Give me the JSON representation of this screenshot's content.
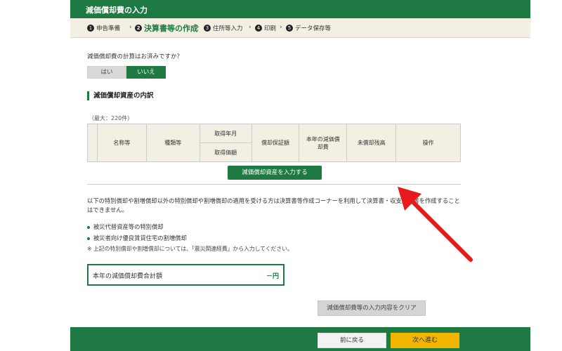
{
  "header": {
    "title": "減価償却費の入力"
  },
  "steps": [
    {
      "num": "1",
      "label": "申告準備"
    },
    {
      "num": "2",
      "label": "決算書等の作成"
    },
    {
      "num": "3",
      "label": "住所等入力"
    },
    {
      "num": "4",
      "label": "印刷"
    },
    {
      "num": "5",
      "label": "データ保存等"
    }
  ],
  "question": {
    "text": "減価償却費の計算はお済みですか？",
    "yes_label": "はい",
    "no_label": "いいえ"
  },
  "assets": {
    "title": "減価償却資産の内訳",
    "max_note": "（最大：220件）",
    "columns": {
      "name": "名称等",
      "type": "種類等",
      "acq_date": "取得年月",
      "acq_price": "取得価額",
      "guarantee": "償却保証額",
      "current": "本年の減価償却費",
      "remaining": "未償却残高",
      "operation": "操作"
    },
    "add_button": "減価償却資産を入力する"
  },
  "notice": {
    "text": "以下の特別償却や割増償却以外の特別償却や割増償却の適用を受ける方は決算書等作成コーナーを利用して決算書・収支内訳書を作成することはできません。",
    "bullets": [
      "被災代替資産等の特別償却",
      "被災者向け優良賃貸住宅の割増償却"
    ],
    "footnote": "※ 上記の特別償却や割増償却については、「震災関連経費」から入力してください。"
  },
  "total": {
    "label": "本年の減価償却費合計額",
    "value": "－円"
  },
  "buttons": {
    "clear": "減価償却費等の入力内容をクリア",
    "back": "前に戻る",
    "next": "次へ進む"
  },
  "colors": {
    "brand_green": "#1e7a42",
    "next_yellow": "#f2b600",
    "annotation_red": "#e8191b"
  }
}
